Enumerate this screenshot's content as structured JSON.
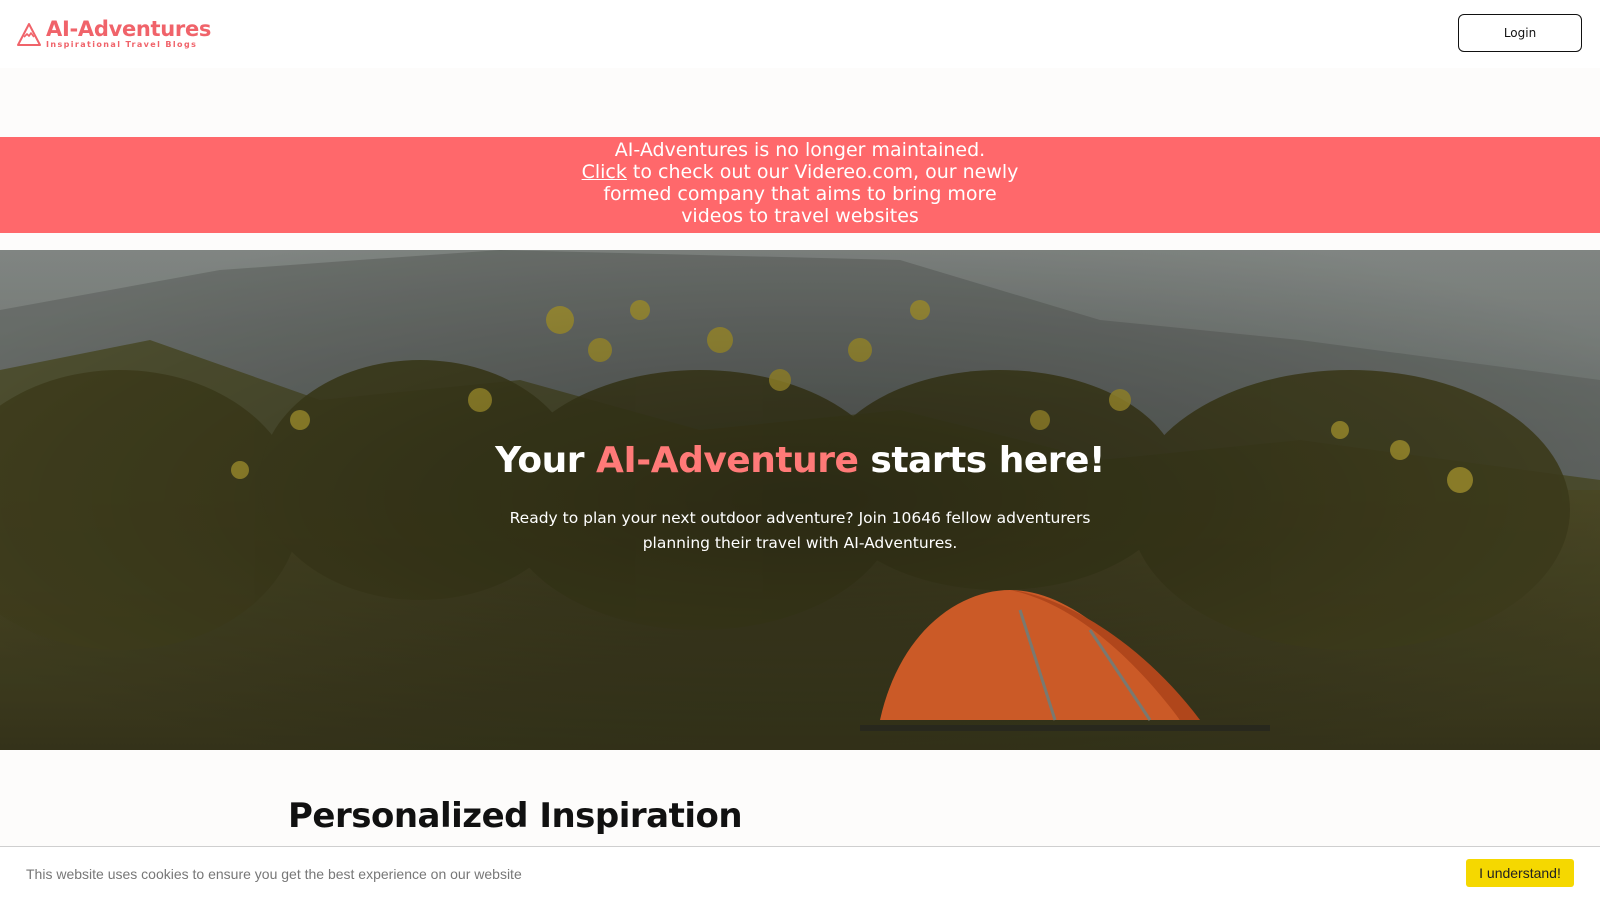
{
  "header": {
    "logo_title": "AI-Adventures",
    "logo_subtitle": "Inspirational Travel Blogs",
    "login_label": "Login"
  },
  "banner": {
    "line1": "AI-Adventures is no longer maintained.",
    "link_label": "Click",
    "line2_rest": " to check out our Videreo.com, our newly formed company that aims to bring more videos to travel websites"
  },
  "hero": {
    "title_before": "Your ",
    "title_accent": "AI-Adventure",
    "title_after": " starts here!",
    "subtitle": "Ready to plan your next outdoor adventure? Join 10646 fellow adventurers planning their travel with AI-Adventures."
  },
  "section": {
    "title": "Personalized Inspiration"
  },
  "cookie": {
    "text": "This website uses cookies to ensure you get the best experience on our website",
    "button_label": "I understand!"
  },
  "colors": {
    "accent": "#f0636a",
    "banner": "#ff686b",
    "cookie_button": "#f5d800"
  }
}
